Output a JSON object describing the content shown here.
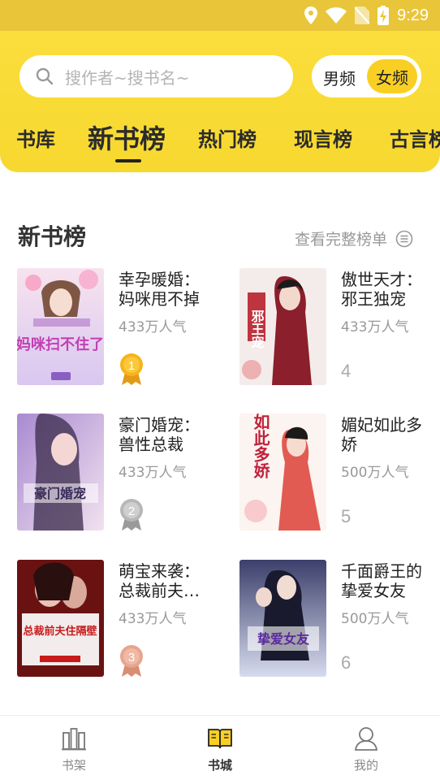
{
  "status_bar": {
    "time": "9:29"
  },
  "search": {
    "placeholder": "搜作者~搜书名~"
  },
  "gender_toggle": {
    "male": "男频",
    "female": "女频",
    "selected": "女频"
  },
  "tabs": [
    {
      "label": "书库"
    },
    {
      "label": "新书榜",
      "active": true
    },
    {
      "label": "热门榜"
    },
    {
      "label": "现言榜"
    },
    {
      "label": "古言榜"
    }
  ],
  "section": {
    "title": "新书榜",
    "view_all": "查看完整榜单"
  },
  "books": [
    {
      "rank": "1",
      "title": "幸孕暖婚：妈咪甩不掉",
      "popularity": "433万人气",
      "cover_text": "妈咪扫不住了"
    },
    {
      "rank": "4",
      "title": "傲世天才：邪王独宠",
      "popularity": "433万人气",
      "cover_text": "邪王宠"
    },
    {
      "rank": "2",
      "title": "豪门婚宠：兽性总裁",
      "popularity": "433万人气",
      "cover_text": "豪门婚宠"
    },
    {
      "rank": "5",
      "title": "媚妃如此多娇",
      "popularity": "500万人气",
      "cover_text": "如此多娇"
    },
    {
      "rank": "3",
      "title": "萌宝来袭：总裁前夫住隔壁",
      "popularity": "433万人气",
      "cover_text": "总裁前夫住隔壁"
    },
    {
      "rank": "6",
      "title": "千面爵王的挚爱女友",
      "popularity": "500万人气",
      "cover_text": "挚爱女友"
    }
  ],
  "colors": {
    "accent": "#f9cf24",
    "header": "#fbde3c",
    "gold": "#f3b21b",
    "silver": "#b7b7b7",
    "bronze": "#e6a58e"
  },
  "bottom_nav": [
    {
      "label": "书架",
      "icon": "bookshelf-icon"
    },
    {
      "label": "书城",
      "icon": "open-book-icon",
      "active": true
    },
    {
      "label": "我的",
      "icon": "user-icon"
    }
  ]
}
